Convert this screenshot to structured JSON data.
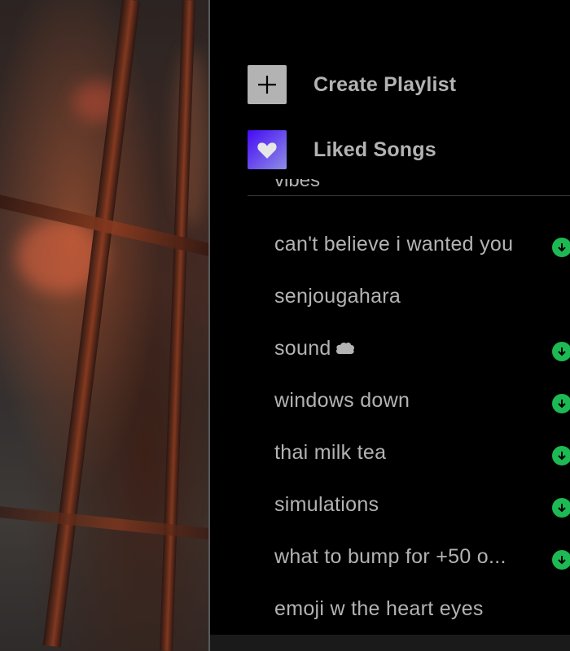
{
  "actions": {
    "create_playlist": "Create Playlist",
    "liked_songs": "Liked Songs"
  },
  "partial_item": "vibes",
  "playlists": [
    {
      "name": "can't believe i wanted you",
      "downloaded": true
    },
    {
      "name": "senjougahara",
      "downloaded": false
    },
    {
      "name": "sound",
      "downloaded": true,
      "icon": "cloud-icon"
    },
    {
      "name": "windows down",
      "downloaded": true
    },
    {
      "name": "thai milk tea",
      "downloaded": true
    },
    {
      "name": "simulations",
      "downloaded": true
    },
    {
      "name": "what to bump for +50 o...",
      "downloaded": true
    },
    {
      "name": "emoji w the heart eyes",
      "downloaded": false
    }
  ],
  "colors": {
    "text": "#b3b3b3",
    "accent_green": "#1db954",
    "background": "#000000"
  }
}
